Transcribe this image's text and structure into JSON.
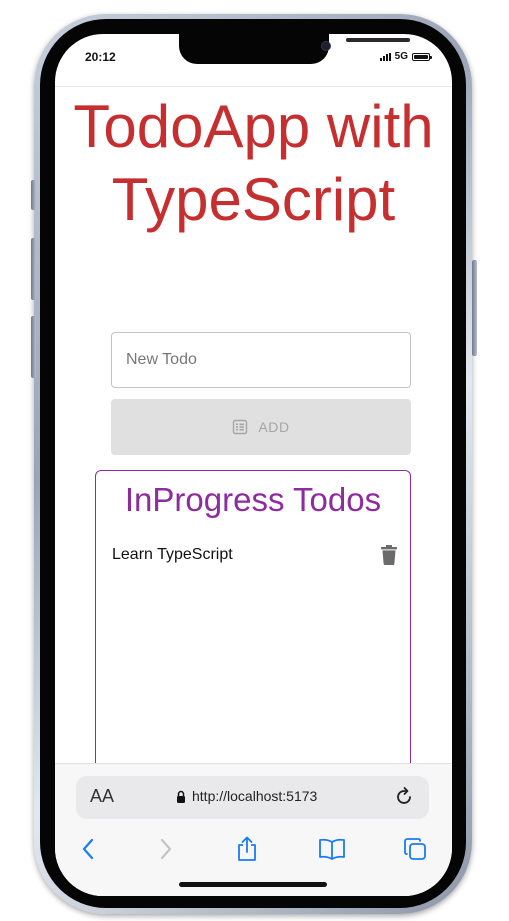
{
  "status_bar": {
    "time": "20:12",
    "network": "5G",
    "icons": [
      "signal-icon",
      "battery-icon"
    ]
  },
  "app": {
    "title": "TodoApp with TypeScript",
    "new_todo_placeholder": "New Todo",
    "new_todo_value": "",
    "add_label": "ADD",
    "add_icon": "list-icon",
    "disabled_color": "#a6a6a6",
    "title_color": "#c62f30"
  },
  "inprogress": {
    "title": "InProgress Todos",
    "accent_color": "#8e2b9e",
    "items": [
      {
        "text": "Learn TypeScript",
        "action_icon": "trash-icon"
      }
    ]
  },
  "browser": {
    "text_size_label": "AA",
    "url": "http://localhost:5173",
    "icons": [
      "lock-icon",
      "reload-icon",
      "back-icon",
      "forward-icon",
      "share-icon",
      "bookmarks-icon",
      "tabs-icon"
    ],
    "accent_color": "#1a7cf5"
  }
}
